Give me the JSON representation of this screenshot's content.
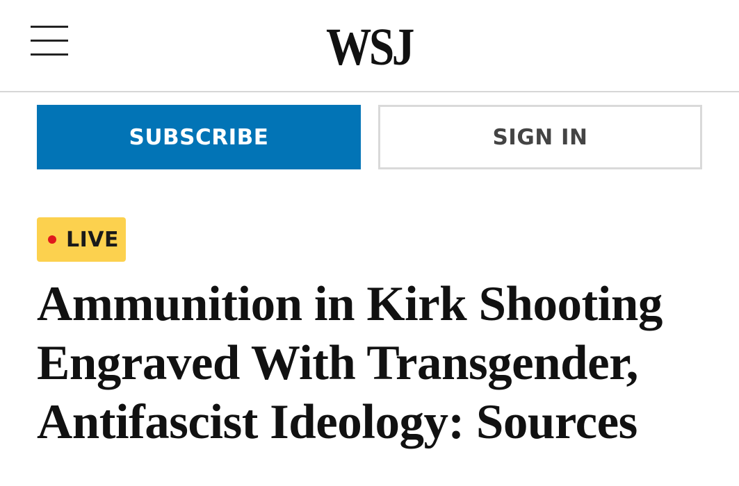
{
  "header": {
    "menu_icon": "hamburger-menu-icon",
    "logo_text": "WSJ"
  },
  "actions": {
    "subscribe_label": "SUBSCRIBE",
    "signin_label": "SIGN IN"
  },
  "article": {
    "badge": {
      "label": "LIVE",
      "icon": "live-dot-icon"
    },
    "headline": "Ammunition in Kirk Shooting Engraved With Transgender, Antifascist Ideology: Sources"
  },
  "colors": {
    "subscribe_bg": "#0274b6",
    "live_badge_bg": "#fcd14e",
    "live_dot": "#e0191c"
  }
}
